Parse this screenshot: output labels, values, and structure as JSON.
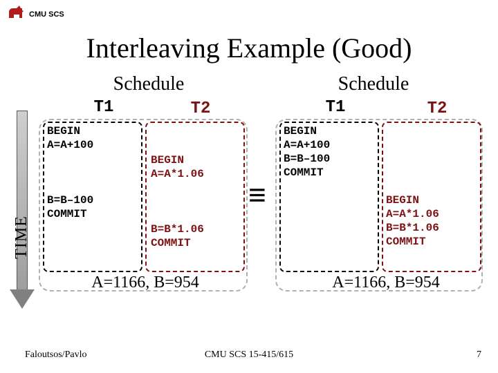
{
  "header": {
    "org": "CMU SCS",
    "icon": "scotty-dog-icon",
    "icon_color": "#B31B1B"
  },
  "title": "Interleaving Example (Good)",
  "time_label": "TIME",
  "left": {
    "schedule_label": "Schedule",
    "t1_label": "T1",
    "t2_label": "T2",
    "t1_block_a": "BEGIN\nA=A+100",
    "t2_block_a": "BEGIN\nA=A*1.06",
    "t1_block_b": "B=B–100\nCOMMIT",
    "t2_block_b": "B=B*1.06\nCOMMIT",
    "result": "A=1166, B=954"
  },
  "right": {
    "schedule_label": "Schedule",
    "t1_label": "T1",
    "t2_label": "T2",
    "t1_block": "BEGIN\nA=A+100\nB=B–100\nCOMMIT",
    "t2_block": "BEGIN\nA=A*1.06\nB=B*1.06\nCOMMIT",
    "result": "A=1166, B=954"
  },
  "equivalence": "≡",
  "footer": {
    "left": "Faloutsos/Pavlo",
    "center": "CMU SCS 15-415/615",
    "page": "7"
  }
}
